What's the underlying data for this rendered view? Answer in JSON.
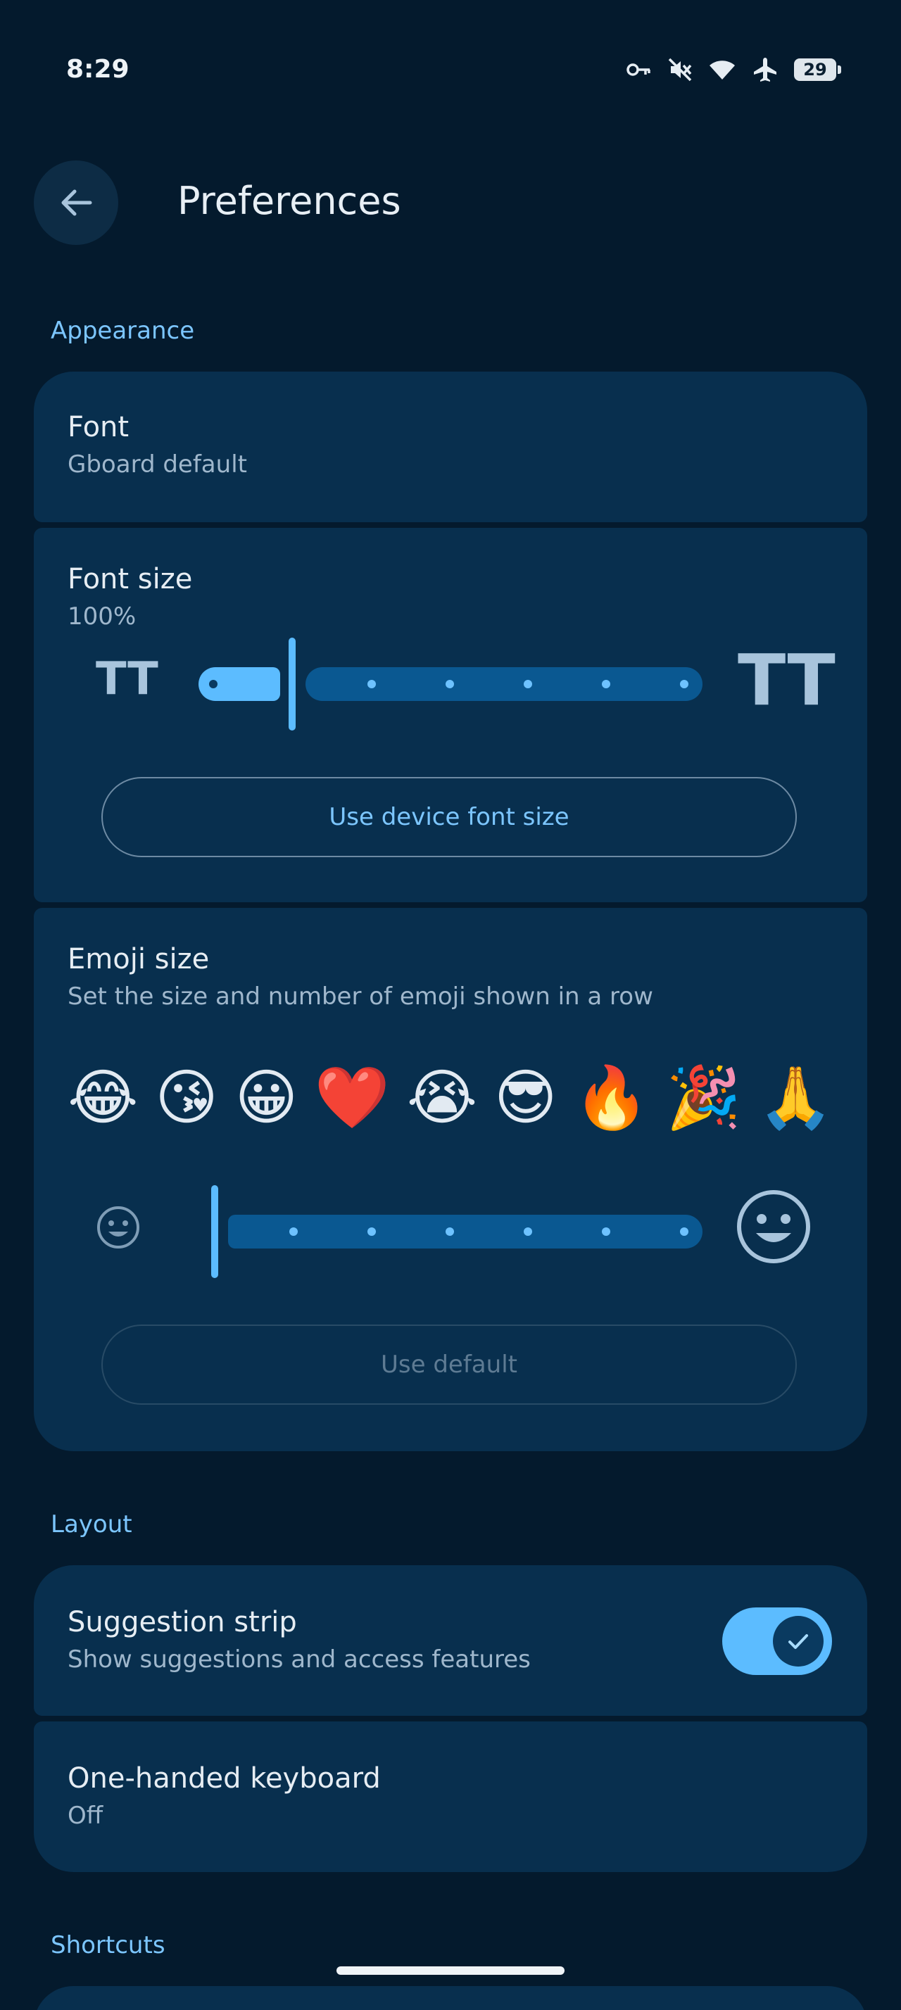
{
  "status_bar": {
    "time": "8:29",
    "battery_level": "29"
  },
  "top_bar": {
    "title": "Preferences"
  },
  "sections": {
    "appearance": "Appearance",
    "layout": "Layout",
    "shortcuts": "Shortcuts"
  },
  "font_row": {
    "title": "Font",
    "subtitle": "Gboard default"
  },
  "font_size": {
    "title": "Font size",
    "value_label": "100%",
    "small_icon_glyph": "TT",
    "large_icon_glyph": "TT",
    "slider_step": 1,
    "slider_steps_total": 7,
    "device_button": "Use device font size"
  },
  "emoji_size": {
    "title": "Emoji size",
    "subtitle": "Set the size and number of emoji shown in a row",
    "emojis": [
      "😂",
      "😘",
      "😀",
      "❤️",
      "😭",
      "😎",
      "🔥",
      "🎉",
      "🙏"
    ],
    "slider_step": 0,
    "slider_steps_total": 7,
    "default_button": "Use default"
  },
  "suggestion_strip": {
    "title": "Suggestion strip",
    "subtitle": "Show suggestions and access features",
    "enabled": true
  },
  "one_handed": {
    "title": "One-handed keyboard",
    "subtitle": "Off"
  },
  "colors": {
    "background": "#041a2d",
    "card": "#082f4e",
    "accent": "#5cbcff",
    "section_header": "#7cc6ff"
  }
}
